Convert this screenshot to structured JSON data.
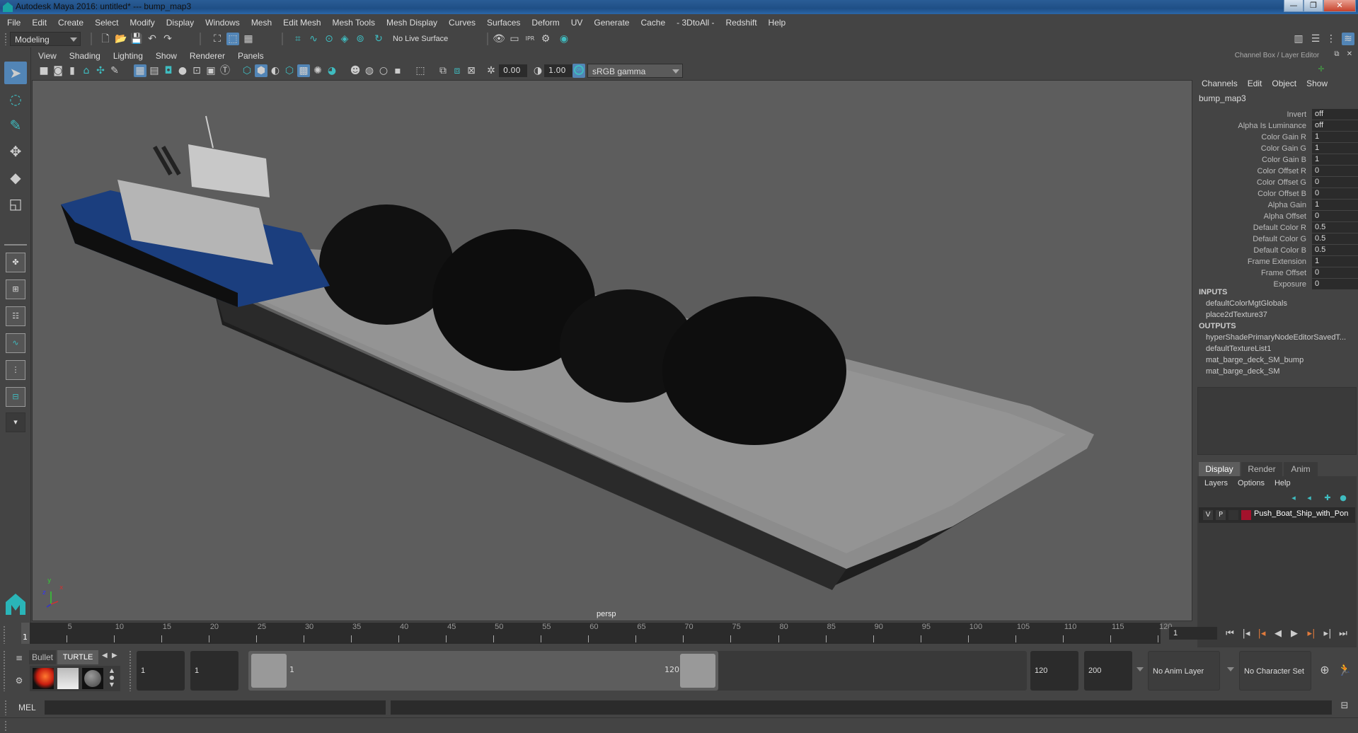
{
  "window": {
    "title": "Autodesk Maya 2016: untitled*   ---   bump_map3",
    "minimize_label": "—",
    "restore_label": "❐",
    "close_label": "✕"
  },
  "menubar": [
    "File",
    "Edit",
    "Create",
    "Select",
    "Modify",
    "Display",
    "Windows",
    "Mesh",
    "Edit Mesh",
    "Mesh Tools",
    "Mesh Display",
    "Curves",
    "Surfaces",
    "Deform",
    "UV",
    "Generate",
    "Cache",
    "- 3DtoAll -",
    "Redshift",
    "Help"
  ],
  "statusline": {
    "menuset": "Modeling",
    "live_surface": "No Live Surface"
  },
  "panel": {
    "menus": [
      "View",
      "Shading",
      "Lighting",
      "Show",
      "Renderer",
      "Panels"
    ],
    "exposure": "0.00",
    "gamma": "1.00",
    "color_mgmt_toggle": "ON",
    "view_transform": "sRGB gamma",
    "camera_label": "persp"
  },
  "axis": {
    "x": "x",
    "y": "y",
    "z": "z"
  },
  "channel_box": {
    "title": "Channel Box / Layer Editor",
    "menus": [
      "Channels",
      "Edit",
      "Object",
      "Show"
    ],
    "node_name": "bump_map3",
    "attributes": [
      {
        "label": "Invert",
        "value": "off"
      },
      {
        "label": "Alpha Is Luminance",
        "value": "off"
      },
      {
        "label": "Color Gain R",
        "value": "1"
      },
      {
        "label": "Color Gain G",
        "value": "1"
      },
      {
        "label": "Color Gain B",
        "value": "1"
      },
      {
        "label": "Color Offset R",
        "value": "0"
      },
      {
        "label": "Color Offset G",
        "value": "0"
      },
      {
        "label": "Color Offset B",
        "value": "0"
      },
      {
        "label": "Alpha Gain",
        "value": "1"
      },
      {
        "label": "Alpha Offset",
        "value": "0"
      },
      {
        "label": "Default Color R",
        "value": "0.5"
      },
      {
        "label": "Default Color G",
        "value": "0.5"
      },
      {
        "label": "Default Color B",
        "value": "0.5"
      },
      {
        "label": "Frame Extension",
        "value": "1"
      },
      {
        "label": "Frame Offset",
        "value": "0"
      },
      {
        "label": "Exposure",
        "value": "0"
      }
    ],
    "inputs_header": "INPUTS",
    "inputs": [
      "defaultColorMgtGlobals",
      "place2dTexture37"
    ],
    "outputs_header": "OUTPUTS",
    "outputs": [
      "hyperShadePrimaryNodeEditorSavedT...",
      "defaultTextureList1",
      "mat_barge_deck_SM_bump",
      "mat_barge_deck_SM"
    ]
  },
  "layer_editor": {
    "tabs": [
      "Display",
      "Render",
      "Anim"
    ],
    "active_tab": "Display",
    "menus": [
      "Layers",
      "Options",
      "Help"
    ],
    "layers": [
      {
        "v": "V",
        "p": "P",
        "color": "#a3122c",
        "name": "Push_Boat_Ship_with_Pon"
      }
    ]
  },
  "timeslider": {
    "ticks": [
      5,
      10,
      15,
      20,
      25,
      30,
      35,
      40,
      45,
      50,
      55,
      60,
      65,
      70,
      75,
      80,
      85,
      90,
      95,
      100,
      105,
      110,
      115,
      120
    ],
    "current_frame_marker": "1",
    "current_frame": "1",
    "min": 1,
    "max": 120
  },
  "range": {
    "shelf_tabs": [
      "Bullet",
      "TURTLE"
    ],
    "start_field": "1",
    "playback_start": "1",
    "range_start_label": "1",
    "range_end_label": "120",
    "playback_end": "120",
    "end_field": "200",
    "anim_layer": "No Anim Layer",
    "character_set": "No Character Set"
  },
  "cmdline": {
    "label": "MEL",
    "input_value": "",
    "result_value": ""
  },
  "colors": {
    "accent": "#5285b6",
    "teal": "#3fbcc0",
    "viewport_bg": "#5d5d5d",
    "key_marker": "#e07a3c"
  }
}
